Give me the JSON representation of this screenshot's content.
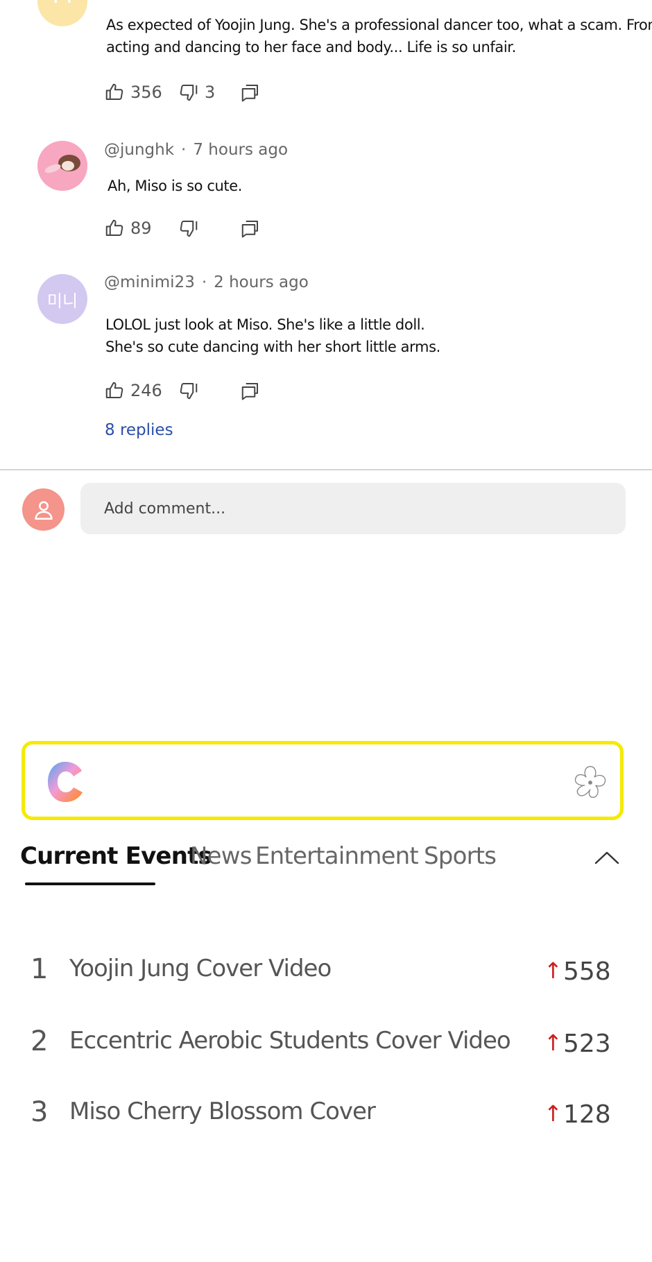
{
  "comments": [
    {
      "avatar_letter": "M",
      "avatar_color": "#fbe6a8",
      "text_lines": [
        "As expected of Yoojin Jung. She's a professional dancer too, what a scam. From",
        "acting and dancing to her face and body... Life is so unfair."
      ],
      "likes": "356",
      "dislikes": "3"
    },
    {
      "username": "@junghk",
      "time": "7 hours ago",
      "avatar_color": "#f7a7c0",
      "text_lines": [
        "Ah, Miso is so cute."
      ],
      "likes": "89",
      "dislikes": ""
    },
    {
      "username": "@minimi23",
      "time": "2 hours ago",
      "avatar_text": "미니",
      "avatar_color": "#d3c8f0",
      "text_lines": [
        "LOLOL just look at Miso. She's like a little doll.",
        "She's so cute dancing with her short little arms."
      ],
      "likes": "246",
      "dislikes": "",
      "replies_label": "8 replies"
    }
  ],
  "meta_separator": "·",
  "composer": {
    "placeholder": "Add comment..."
  },
  "tabs": [
    {
      "label": "Current Events",
      "active": true
    },
    {
      "label": "News",
      "active": false
    },
    {
      "label": "Entertainment",
      "active": false
    },
    {
      "label": "Sports",
      "active": false
    }
  ],
  "trending": [
    {
      "rank": "1",
      "title": "Yoojin Jung Cover Video",
      "count": "558"
    },
    {
      "rank": "2",
      "title": "Eccentric Aerobic Students Cover Video",
      "count": "523"
    },
    {
      "rank": "3",
      "title": "Miso Cherry Blossom Cover",
      "count": "128"
    }
  ],
  "trend_arrow": "↑",
  "colors": {
    "highlight_border": "#f5ea00",
    "link": "#2a4ea6",
    "trend_up": "#cc1f1f",
    "composer_avatar": "#f4948a"
  }
}
